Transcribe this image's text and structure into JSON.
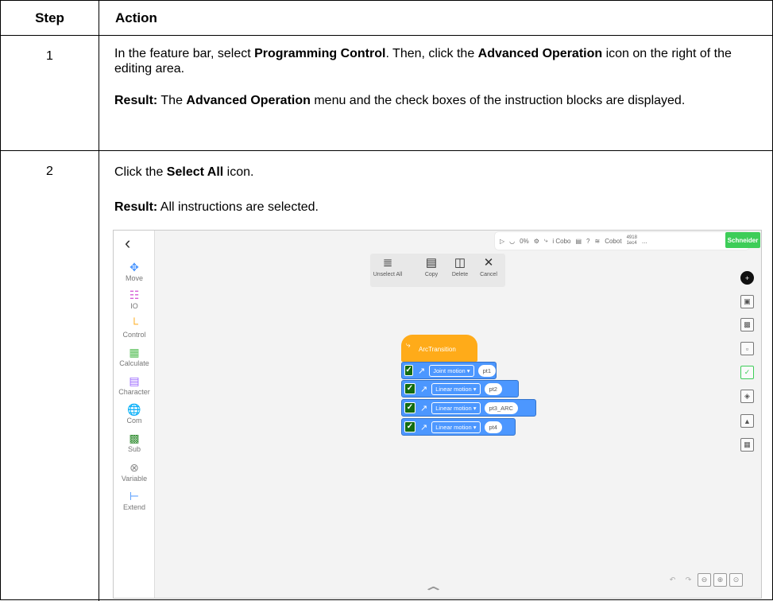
{
  "table": {
    "headers": {
      "step": "Step",
      "action": "Action"
    },
    "rows": [
      {
        "step": "1",
        "p1": {
          "t1": "In the feature bar, select ",
          "b1": "Programming Control",
          "t2": ". Then, click the ",
          "b2": "Advanced Operation",
          "t3": " icon on the right of the editing area."
        },
        "p2": {
          "b1": "Result:",
          "t1": " The ",
          "b2": "Advanced Operation",
          "t2": " menu and the check boxes of the instruction blocks are displayed."
        }
      },
      {
        "step": "2",
        "p1": {
          "t1": "Click the ",
          "b1": "Select All",
          "t2": " icon."
        },
        "p2": {
          "b1": "Result:",
          "t1": " All instructions are selected."
        }
      }
    ]
  },
  "screenshot": {
    "sidebar": {
      "back_icon": "chevron-left-icon",
      "items": [
        {
          "label": "Move",
          "icon": "move-icon",
          "color": "#4c97ff"
        },
        {
          "label": "IO",
          "icon": "io-icon",
          "color": "#d65cd6"
        },
        {
          "label": "Control",
          "icon": "control-icon",
          "color": "#ffab19"
        },
        {
          "label": "Calculate",
          "icon": "calculate-icon",
          "color": "#59c059"
        },
        {
          "label": "Character",
          "icon": "character-icon",
          "color": "#9966ff"
        },
        {
          "label": "Com",
          "icon": "com-icon",
          "color": "#555555"
        },
        {
          "label": "Sub",
          "icon": "sub-icon",
          "color": "#2e8b2e"
        },
        {
          "label": "Variable",
          "icon": "variable-icon",
          "color": "#888888"
        },
        {
          "label": "Extend",
          "icon": "extend-icon",
          "color": "#4c97ff"
        }
      ]
    },
    "topbar": {
      "speed": "0%",
      "cobot_label": "i Cobo",
      "cobot_name": "Cobot",
      "count_top": "4918",
      "count_bottom": "1ec4",
      "more": "...",
      "brand": "Schneider",
      "brand_color": "#3dcd58"
    },
    "op_menu": {
      "unselect_all": "Unselect All",
      "copy": "Copy",
      "delete": "Delete",
      "cancel": "Cancel"
    },
    "blocks": {
      "hat_label": "ArcTransition",
      "hat_color": "#ffab19",
      "rows": [
        {
          "motion": "Joint motion",
          "point": "pt1"
        },
        {
          "motion": "Linear motion",
          "point": "pt2"
        },
        {
          "motion": "Linear motion",
          "point": "pt3_ARC"
        },
        {
          "motion": "Linear motion",
          "point": "pt4"
        }
      ],
      "block_color": "#4c97ff",
      "check_color": "#136c11"
    }
  }
}
